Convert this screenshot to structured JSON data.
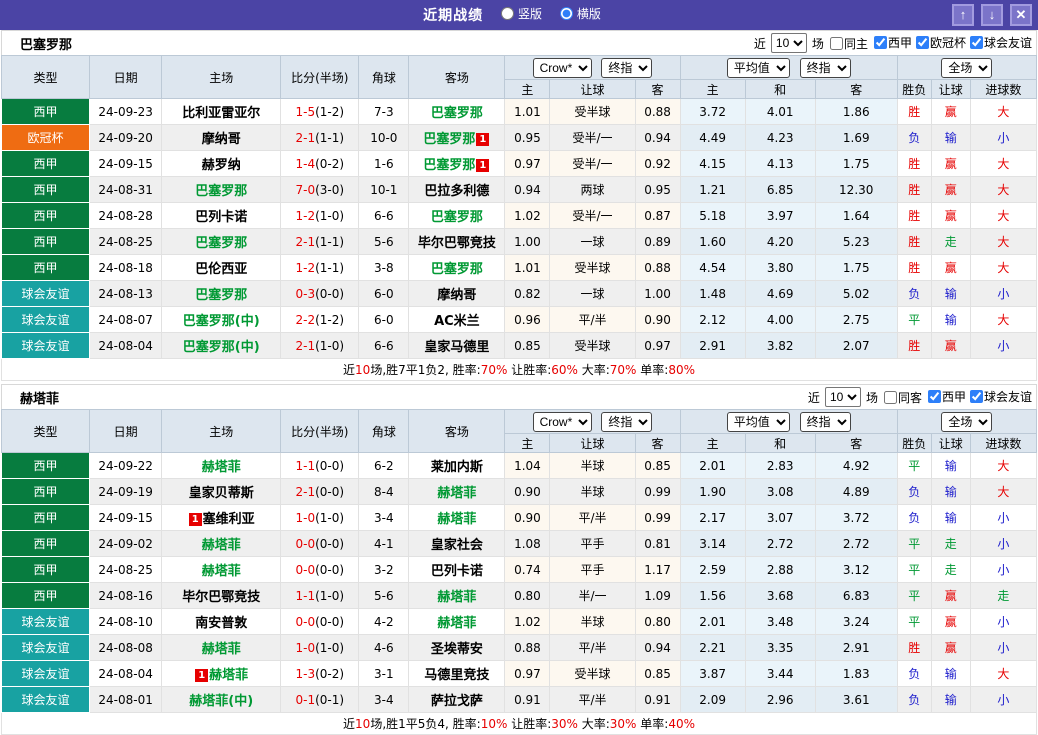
{
  "topbar": {
    "title": "近期战绩",
    "radio_vertical": "竖版",
    "radio_horizontal": "横版",
    "selected": "横版",
    "buttons": {
      "up": "↑",
      "down": "↓",
      "close": "✕"
    }
  },
  "palette": {
    "topbar_bg": "#4b44a5",
    "header_bg": "#dde6ef",
    "focus_team_green": "#009933",
    "win_red": "#e60000",
    "lose_blue": "#1c1ccc",
    "draw_green": "#009933",
    "avg_col_bg": "#eaf4fa",
    "crow_col_bg": "#fdf8f0",
    "stripe_gray": "#efefef"
  },
  "type_colors": {
    "西甲": "#077c3f",
    "欧冠杯": "#ef6c12",
    "球会友谊": "#18a2a2"
  },
  "outcome_colors": {
    "胜": "#e60000",
    "赢": "#e60000",
    "大": "#e60000",
    "平": "#009933",
    "走": "#009933",
    "负": "#1c1ccc",
    "输": "#1c1ccc",
    "小": "#1c1ccc"
  },
  "columns": [
    "类型",
    "日期",
    "主场",
    "比分(半场)",
    "角球",
    "客场"
  ],
  "odds_headers": {
    "selects": [
      "Crow*",
      "终指",
      "平均值",
      "终指",
      "全场"
    ],
    "sub": [
      "主",
      "让球",
      "客",
      "主",
      "和",
      "客",
      "胜负",
      "让球",
      "进球数"
    ]
  },
  "sections": [
    {
      "team": "巴塞罗那",
      "filter": {
        "near_label": "近",
        "count": "10",
        "games_label": "场",
        "same_label": "同主",
        "same_checked": false,
        "leagues": [
          {
            "label": "西甲",
            "checked": true
          },
          {
            "label": "欧冠杯",
            "checked": true
          },
          {
            "label": "球会友谊",
            "checked": true
          }
        ]
      },
      "rows": [
        {
          "type": "西甲",
          "date": "24-09-23",
          "home": {
            "name": "比利亚雷亚尔",
            "focus": false
          },
          "score": [
            "1-5",
            "(1-2)"
          ],
          "corner": "7-3",
          "away": {
            "name": "巴塞罗那",
            "focus": true
          },
          "odds": [
            "1.01",
            "受半球",
            "0.88"
          ],
          "avg": [
            "3.72",
            "4.01",
            "1.86"
          ],
          "result": [
            "胜",
            "赢",
            "大"
          ]
        },
        {
          "type": "欧冠杯",
          "date": "24-09-20",
          "home": {
            "name": "摩纳哥",
            "focus": false
          },
          "score": [
            "2-1",
            "(1-1)"
          ],
          "corner": "10-0",
          "away": {
            "name": "巴塞罗那",
            "focus": true,
            "card": "1",
            "card_pos": "after"
          },
          "odds": [
            "0.95",
            "受半/一",
            "0.94"
          ],
          "avg": [
            "4.49",
            "4.23",
            "1.69"
          ],
          "result": [
            "负",
            "输",
            "小"
          ]
        },
        {
          "type": "西甲",
          "date": "24-09-15",
          "home": {
            "name": "赫罗纳",
            "focus": false
          },
          "score": [
            "1-4",
            "(0-2)"
          ],
          "corner": "1-6",
          "away": {
            "name": "巴塞罗那",
            "focus": true,
            "card": "1",
            "card_pos": "after"
          },
          "odds": [
            "0.97",
            "受半/一",
            "0.92"
          ],
          "avg": [
            "4.15",
            "4.13",
            "1.75"
          ],
          "result": [
            "胜",
            "赢",
            "大"
          ]
        },
        {
          "type": "西甲",
          "date": "24-08-31",
          "home": {
            "name": "巴塞罗那",
            "focus": true
          },
          "score": [
            "7-0",
            "(3-0)"
          ],
          "corner": "10-1",
          "away": {
            "name": "巴拉多利德",
            "focus": false
          },
          "odds": [
            "0.94",
            "两球",
            "0.95"
          ],
          "avg": [
            "1.21",
            "6.85",
            "12.30"
          ],
          "result": [
            "胜",
            "赢",
            "大"
          ]
        },
        {
          "type": "西甲",
          "date": "24-08-28",
          "home": {
            "name": "巴列卡诺",
            "focus": false
          },
          "score": [
            "1-2",
            "(1-0)"
          ],
          "corner": "6-6",
          "away": {
            "name": "巴塞罗那",
            "focus": true
          },
          "odds": [
            "1.02",
            "受半/一",
            "0.87"
          ],
          "avg": [
            "5.18",
            "3.97",
            "1.64"
          ],
          "result": [
            "胜",
            "赢",
            "大"
          ]
        },
        {
          "type": "西甲",
          "date": "24-08-25",
          "home": {
            "name": "巴塞罗那",
            "focus": true
          },
          "score": [
            "2-1",
            "(1-1)"
          ],
          "corner": "5-6",
          "away": {
            "name": "毕尔巴鄂竞技",
            "focus": false
          },
          "odds": [
            "1.00",
            "一球",
            "0.89"
          ],
          "avg": [
            "1.60",
            "4.20",
            "5.23"
          ],
          "result": [
            "胜",
            "走",
            "大"
          ]
        },
        {
          "type": "西甲",
          "date": "24-08-18",
          "home": {
            "name": "巴伦西亚",
            "focus": false
          },
          "score": [
            "1-2",
            "(1-1)"
          ],
          "corner": "3-8",
          "away": {
            "name": "巴塞罗那",
            "focus": true
          },
          "odds": [
            "1.01",
            "受半球",
            "0.88"
          ],
          "avg": [
            "4.54",
            "3.80",
            "1.75"
          ],
          "result": [
            "胜",
            "赢",
            "大"
          ]
        },
        {
          "type": "球会友谊",
          "date": "24-08-13",
          "home": {
            "name": "巴塞罗那",
            "focus": true
          },
          "score": [
            "0-3",
            "(0-0)"
          ],
          "corner": "6-0",
          "away": {
            "name": "摩纳哥",
            "focus": false
          },
          "odds": [
            "0.82",
            "一球",
            "1.00"
          ],
          "avg": [
            "1.48",
            "4.69",
            "5.02"
          ],
          "result": [
            "负",
            "输",
            "小"
          ]
        },
        {
          "type": "球会友谊",
          "date": "24-08-07",
          "home": {
            "name": "巴塞罗那(中)",
            "focus": true
          },
          "score": [
            "2-2",
            "(1-2)"
          ],
          "corner": "6-0",
          "away": {
            "name": "AC米兰",
            "focus": false
          },
          "odds": [
            "0.96",
            "平/半",
            "0.90"
          ],
          "avg": [
            "2.12",
            "4.00",
            "2.75"
          ],
          "result": [
            "平",
            "输",
            "大"
          ]
        },
        {
          "type": "球会友谊",
          "date": "24-08-04",
          "home": {
            "name": "巴塞罗那(中)",
            "focus": true
          },
          "score": [
            "2-1",
            "(1-0)"
          ],
          "corner": "6-6",
          "away": {
            "name": "皇家马德里",
            "focus": false
          },
          "odds": [
            "0.85",
            "受半球",
            "0.97"
          ],
          "avg": [
            "2.91",
            "3.82",
            "2.07"
          ],
          "result": [
            "胜",
            "赢",
            "小"
          ]
        }
      ],
      "summary": [
        [
          "近",
          0
        ],
        [
          "10",
          1
        ],
        [
          "场,胜7平1负2, 胜率:",
          0
        ],
        [
          "70%",
          1
        ],
        [
          " 让胜率:",
          0
        ],
        [
          "60%",
          1
        ],
        [
          " 大率:",
          0
        ],
        [
          "70%",
          1
        ],
        [
          " 单率:",
          0
        ],
        [
          "80%",
          1
        ]
      ]
    },
    {
      "team": "赫塔菲",
      "filter": {
        "near_label": "近",
        "count": "10",
        "games_label": "场",
        "same_label": "同客",
        "same_checked": false,
        "leagues": [
          {
            "label": "西甲",
            "checked": true
          },
          {
            "label": "球会友谊",
            "checked": true
          }
        ]
      },
      "rows": [
        {
          "type": "西甲",
          "date": "24-09-22",
          "home": {
            "name": "赫塔菲",
            "focus": true
          },
          "score": [
            "1-1",
            "(0-0)"
          ],
          "corner": "6-2",
          "away": {
            "name": "莱加内斯",
            "focus": false
          },
          "odds": [
            "1.04",
            "半球",
            "0.85"
          ],
          "avg": [
            "2.01",
            "2.83",
            "4.92"
          ],
          "result": [
            "平",
            "输",
            "大"
          ]
        },
        {
          "type": "西甲",
          "date": "24-09-19",
          "home": {
            "name": "皇家贝蒂斯",
            "focus": false
          },
          "score": [
            "2-1",
            "(0-0)"
          ],
          "corner": "8-4",
          "away": {
            "name": "赫塔菲",
            "focus": true
          },
          "odds": [
            "0.90",
            "半球",
            "0.99"
          ],
          "avg": [
            "1.90",
            "3.08",
            "4.89"
          ],
          "result": [
            "负",
            "输",
            "大"
          ]
        },
        {
          "type": "西甲",
          "date": "24-09-15",
          "home": {
            "name": "塞维利亚",
            "focus": false,
            "card": "1",
            "card_pos": "before"
          },
          "score": [
            "1-0",
            "(1-0)"
          ],
          "corner": "3-4",
          "away": {
            "name": "赫塔菲",
            "focus": true
          },
          "odds": [
            "0.90",
            "平/半",
            "0.99"
          ],
          "avg": [
            "2.17",
            "3.07",
            "3.72"
          ],
          "result": [
            "负",
            "输",
            "小"
          ]
        },
        {
          "type": "西甲",
          "date": "24-09-02",
          "home": {
            "name": "赫塔菲",
            "focus": true
          },
          "score": [
            "0-0",
            "(0-0)"
          ],
          "corner": "4-1",
          "away": {
            "name": "皇家社会",
            "focus": false
          },
          "odds": [
            "1.08",
            "平手",
            "0.81"
          ],
          "avg": [
            "3.14",
            "2.72",
            "2.72"
          ],
          "result": [
            "平",
            "走",
            "小"
          ]
        },
        {
          "type": "西甲",
          "date": "24-08-25",
          "home": {
            "name": "赫塔菲",
            "focus": true
          },
          "score": [
            "0-0",
            "(0-0)"
          ],
          "corner": "3-2",
          "away": {
            "name": "巴列卡诺",
            "focus": false
          },
          "odds": [
            "0.74",
            "平手",
            "1.17"
          ],
          "avg": [
            "2.59",
            "2.88",
            "3.12"
          ],
          "result": [
            "平",
            "走",
            "小"
          ]
        },
        {
          "type": "西甲",
          "date": "24-08-16",
          "home": {
            "name": "毕尔巴鄂竞技",
            "focus": false
          },
          "score": [
            "1-1",
            "(1-0)"
          ],
          "corner": "5-6",
          "away": {
            "name": "赫塔菲",
            "focus": true
          },
          "odds": [
            "0.80",
            "半/一",
            "1.09"
          ],
          "avg": [
            "1.56",
            "3.68",
            "6.83"
          ],
          "result": [
            "平",
            "赢",
            "走"
          ]
        },
        {
          "type": "球会友谊",
          "date": "24-08-10",
          "home": {
            "name": "南安普敦",
            "focus": false
          },
          "score": [
            "0-0",
            "(0-0)"
          ],
          "corner": "4-2",
          "away": {
            "name": "赫塔菲",
            "focus": true
          },
          "odds": [
            "1.02",
            "半球",
            "0.80"
          ],
          "avg": [
            "2.01",
            "3.48",
            "3.24"
          ],
          "result": [
            "平",
            "赢",
            "小"
          ]
        },
        {
          "type": "球会友谊",
          "date": "24-08-08",
          "home": {
            "name": "赫塔菲",
            "focus": true
          },
          "score": [
            "1-0",
            "(1-0)"
          ],
          "corner": "4-6",
          "away": {
            "name": "圣埃蒂安",
            "focus": false
          },
          "odds": [
            "0.88",
            "平/半",
            "0.94"
          ],
          "avg": [
            "2.21",
            "3.35",
            "2.91"
          ],
          "result": [
            "胜",
            "赢",
            "小"
          ]
        },
        {
          "type": "球会友谊",
          "date": "24-08-04",
          "home": {
            "name": "赫塔菲",
            "focus": true,
            "card": "1",
            "card_pos": "before"
          },
          "score": [
            "1-3",
            "(0-2)"
          ],
          "corner": "3-1",
          "away": {
            "name": "马德里竞技",
            "focus": false
          },
          "odds": [
            "0.97",
            "受半球",
            "0.85"
          ],
          "avg": [
            "3.87",
            "3.44",
            "1.83"
          ],
          "result": [
            "负",
            "输",
            "大"
          ]
        },
        {
          "type": "球会友谊",
          "date": "24-08-01",
          "home": {
            "name": "赫塔菲(中)",
            "focus": true
          },
          "score": [
            "0-1",
            "(0-1)"
          ],
          "corner": "3-4",
          "away": {
            "name": "萨拉戈萨",
            "focus": false
          },
          "odds": [
            "0.91",
            "平/半",
            "0.91"
          ],
          "avg": [
            "2.09",
            "2.96",
            "3.61"
          ],
          "result": [
            "负",
            "输",
            "小"
          ]
        }
      ],
      "summary": [
        [
          "近",
          0
        ],
        [
          "10",
          1
        ],
        [
          "场,胜1平5负4, 胜率:",
          0
        ],
        [
          "10%",
          1
        ],
        [
          " 让胜率:",
          0
        ],
        [
          "30%",
          1
        ],
        [
          " 大率:",
          0
        ],
        [
          "30%",
          1
        ],
        [
          " 单率:",
          0
        ],
        [
          "40%",
          1
        ]
      ]
    }
  ]
}
